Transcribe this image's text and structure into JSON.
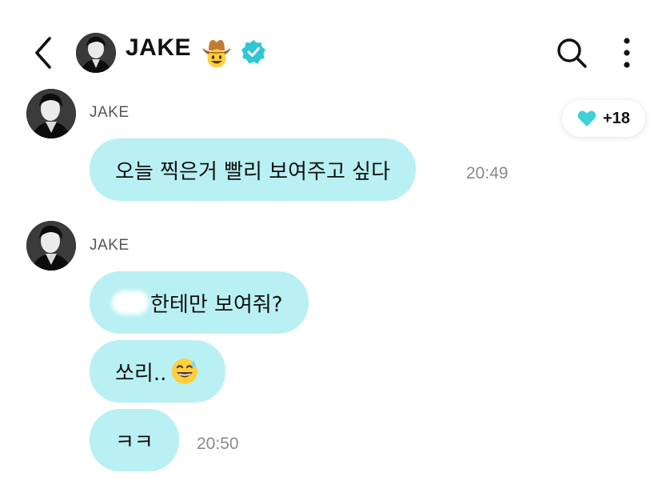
{
  "header": {
    "title": "JAKE",
    "title_emoji": "cowboy-face",
    "badge": "verified",
    "accent_color": "#2ec7d2",
    "icons": [
      "back-arrow-icon",
      "search-icon",
      "more-vertical-icon"
    ]
  },
  "reaction": {
    "icon": "heart-icon",
    "color": "#3fd0d8",
    "count": "+18"
  },
  "messages": [
    {
      "sender": "JAKE",
      "bubbles": [
        {
          "text": "오늘 찍은거 빨리 보여주고 싶다",
          "time": "20:49"
        }
      ]
    },
    {
      "sender": "JAKE",
      "bubbles": [
        {
          "text": "한테만 보여줘?",
          "has_blurred_name": true
        },
        {
          "text": "쏘리.. ",
          "emoji": "grinning-sweat"
        },
        {
          "text": "ㅋㅋ",
          "time": "20:50"
        }
      ]
    }
  ],
  "bubble_color": "#b9f0f3"
}
